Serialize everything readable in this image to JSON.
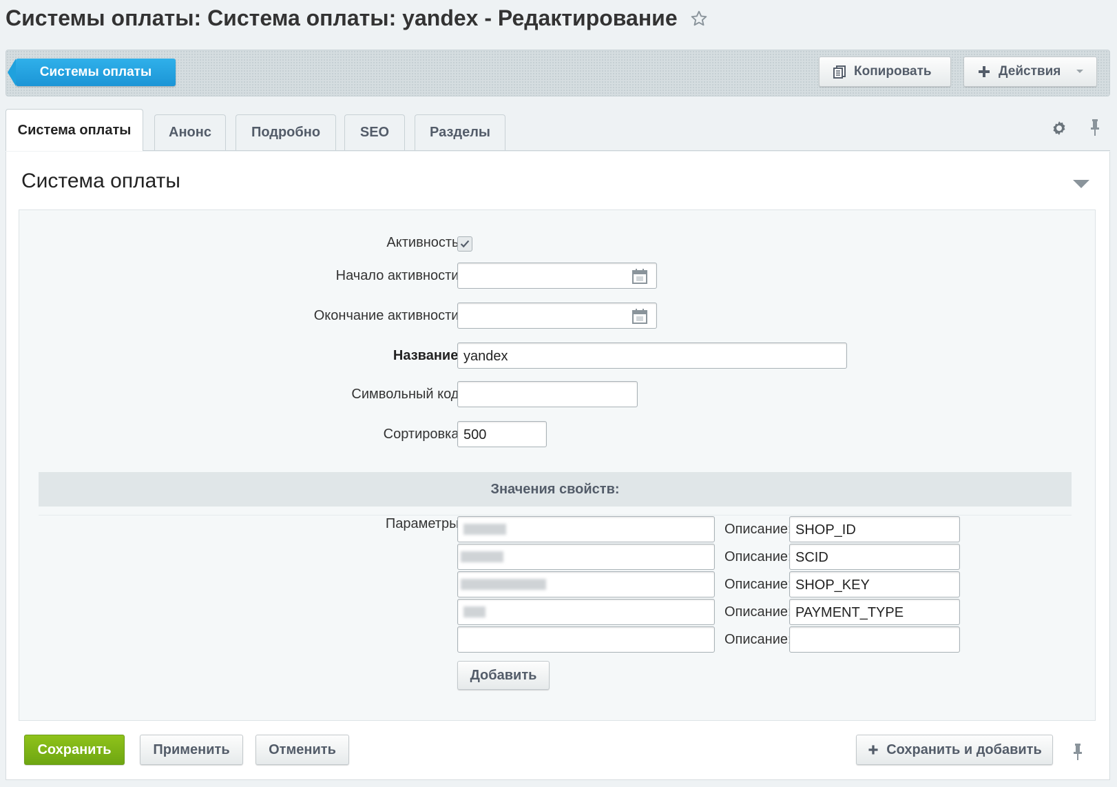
{
  "page": {
    "title": "Системы оплаты: Система оплаты: yandex - Редактирование"
  },
  "toolbar": {
    "back_label": "Системы оплаты",
    "copy_label": "Копировать",
    "actions_label": "Действия"
  },
  "tabs": [
    {
      "label": "Система оплаты",
      "active": true
    },
    {
      "label": "Анонс"
    },
    {
      "label": "Подробно"
    },
    {
      "label": "SEO"
    },
    {
      "label": "Разделы"
    }
  ],
  "section": {
    "title": "Система оплаты"
  },
  "form": {
    "active_label": "Активность:",
    "active_checked": true,
    "start_label": "Начало активности:",
    "start_value": "",
    "end_label": "Окончание активности:",
    "end_value": "",
    "name_label": "Название:",
    "name_value": "yandex",
    "code_label": "Символьный код:",
    "code_value": "",
    "sort_label": "Сортировка:",
    "sort_value": "500"
  },
  "properties": {
    "header": "Значения свойств:",
    "params_label": "Параметры:",
    "desc_label": "Описание:",
    "rows": [
      {
        "description": "SHOP_ID"
      },
      {
        "description": "SCID"
      },
      {
        "description": "SHOP_KEY"
      },
      {
        "description": "PAYMENT_TYPE"
      },
      {
        "description": ""
      }
    ],
    "add_label": "Добавить"
  },
  "footer": {
    "save_label": "Сохранить",
    "apply_label": "Применить",
    "cancel_label": "Отменить",
    "save_add_label": "Сохранить и добавить"
  },
  "colors": {
    "accent_blue": "#1c95d6",
    "save_green": "#7ab317"
  }
}
